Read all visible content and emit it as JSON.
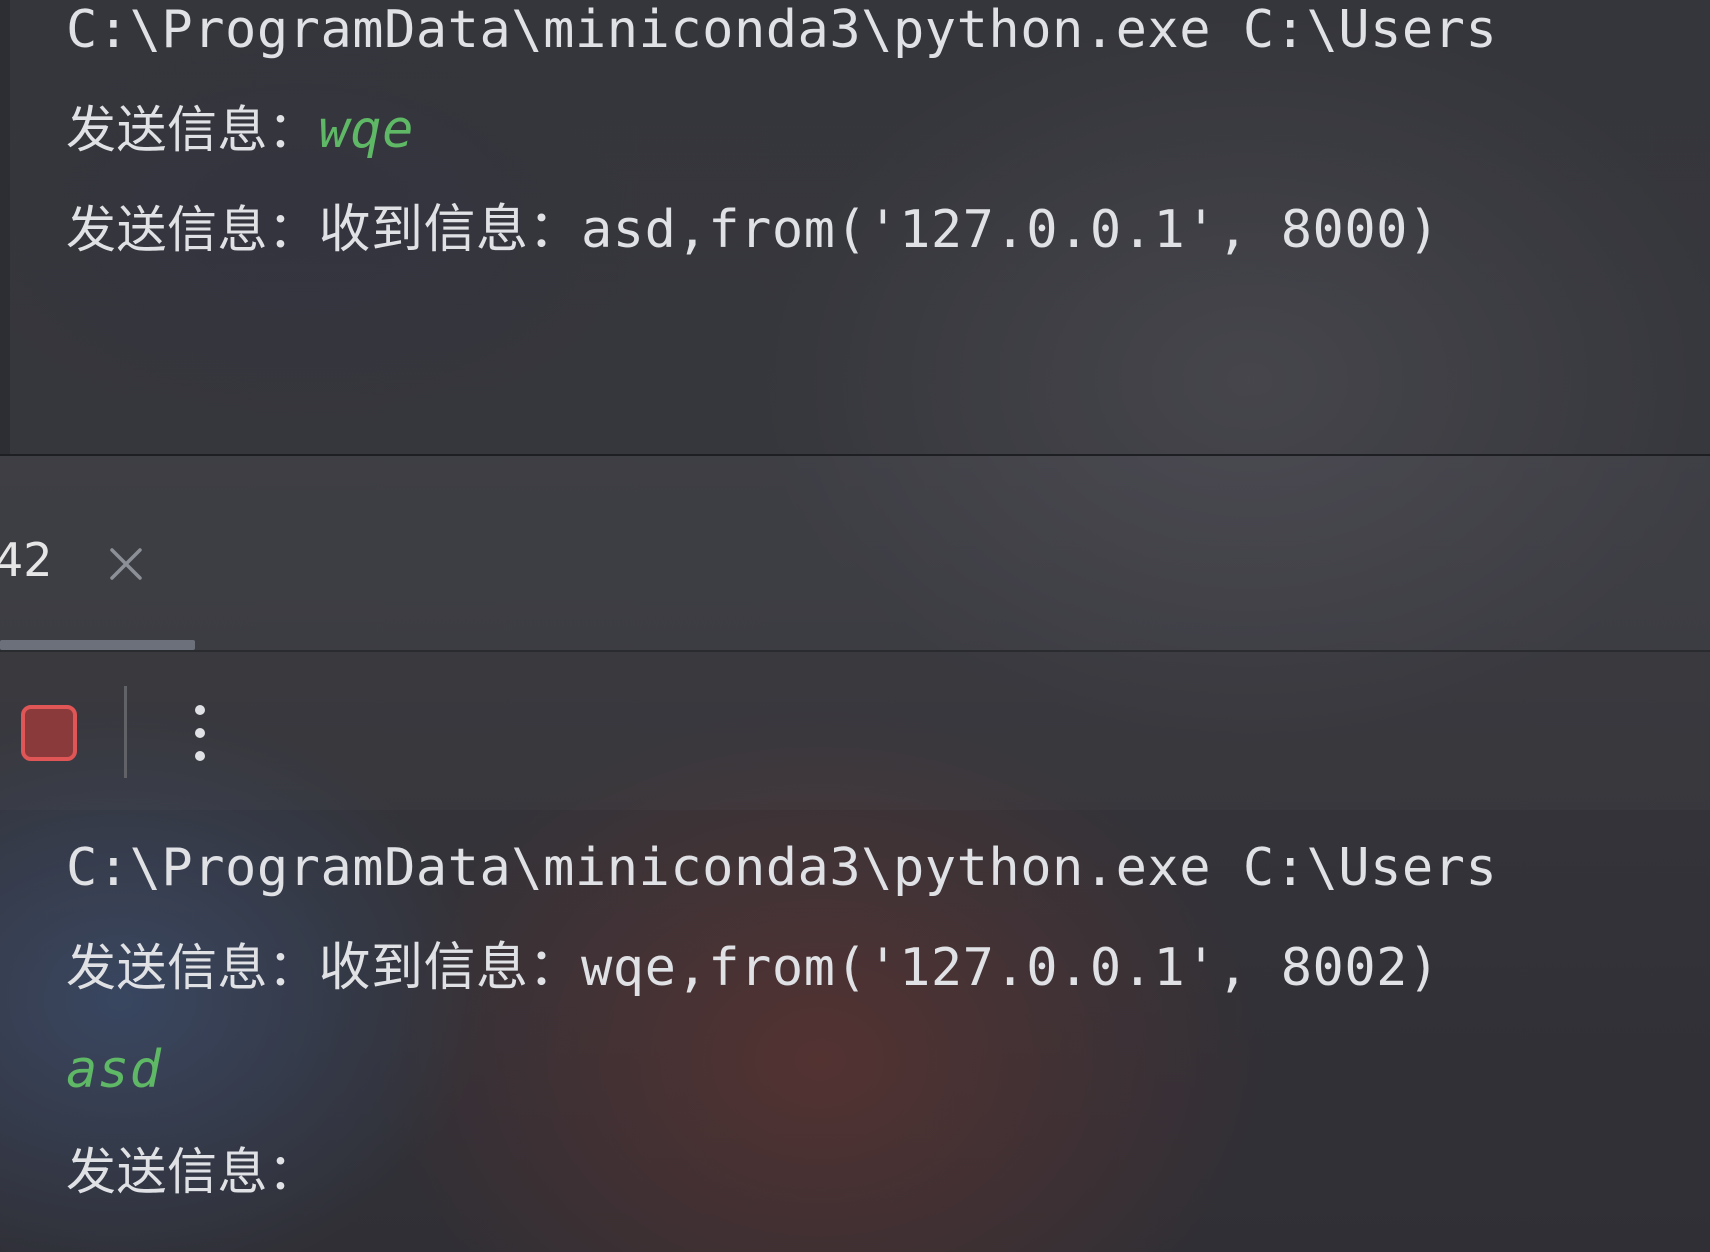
{
  "top_console": {
    "lines": [
      {
        "kind": "cmd",
        "text": "C:\\ProgramData\\miniconda3\\python.exe C:\\Users"
      },
      {
        "kind": "prompt_input",
        "prompt": "发送信息：",
        "input": "wqe"
      },
      {
        "kind": "prompt_output",
        "prompt": "发送信息：",
        "text": "收到信息：asd,from('127.0.0.1', 8000)"
      }
    ]
  },
  "run_tab": {
    "label": "42",
    "close_icon": "close-icon"
  },
  "toolbar": {
    "stop_icon": "stop-icon",
    "more_icon": "more-vertical-icon"
  },
  "bottom_console": {
    "lines": [
      {
        "kind": "cmd",
        "text": "C:\\ProgramData\\miniconda3\\python.exe C:\\Users"
      },
      {
        "kind": "prompt_output",
        "prompt": "发送信息：",
        "text": "收到信息：wqe,from('127.0.0.1', 8002)"
      },
      {
        "kind": "input",
        "input": "asd"
      },
      {
        "kind": "prompt",
        "prompt": "发送信息："
      }
    ]
  },
  "colors": {
    "background": "#2b2d30",
    "text": "#dfe1e5",
    "user_input": "#5fb865",
    "stop_fill": "#8a3a3a",
    "stop_border": "#e05555"
  }
}
